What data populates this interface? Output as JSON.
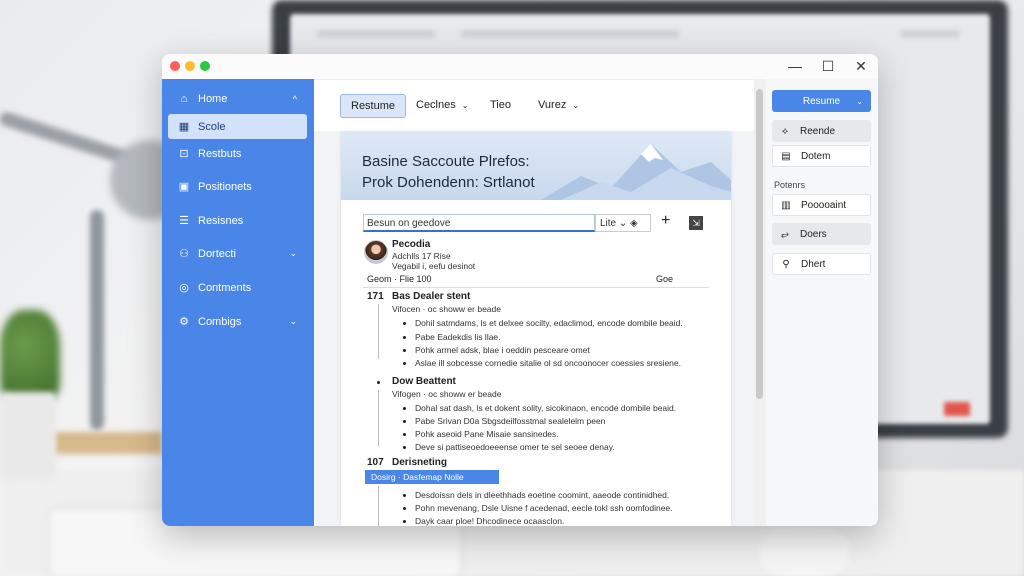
{
  "window": {
    "controls": {
      "minimize": "—",
      "maximize": "☐",
      "close": "✕"
    }
  },
  "sidebar": {
    "items": [
      {
        "label": "Home",
        "icon": "home-icon",
        "glyph": "⌂",
        "chevron": "^"
      },
      {
        "label": "Scole",
        "icon": "grid-icon",
        "glyph": "▦",
        "active": true
      },
      {
        "label": "Restbuts",
        "icon": "chart-icon",
        "glyph": "⊡"
      },
      {
        "label": "Positionets",
        "icon": "card-icon",
        "glyph": "▣"
      },
      {
        "label": "Resisnes",
        "icon": "list-icon",
        "glyph": "☰"
      },
      {
        "label": "Dortecti",
        "icon": "person-icon",
        "glyph": "⚇",
        "chevron": "⌄"
      },
      {
        "label": "Contments",
        "icon": "comment-icon",
        "glyph": "◎"
      },
      {
        "label": "Combigs",
        "icon": "gear-icon",
        "glyph": "⚙",
        "chevron": "⌄"
      }
    ]
  },
  "toolbar": {
    "tabs": [
      {
        "label": "Restume",
        "active": true
      },
      {
        "label": "Ceclnes",
        "chevron": "⌄"
      },
      {
        "label": "Tieo"
      },
      {
        "label": "Vurez",
        "chevron": "⌄"
      }
    ]
  },
  "doc": {
    "title_line1": "Basine Saccoute Plrefos:",
    "title_line2": "Prok Dohendenn: Srtlanot",
    "search_placeholder": "Besun on geedove",
    "lite": "Lite ⌄  ◈",
    "add": "+",
    "export": "⇲",
    "profile": {
      "name": "Pecodia",
      "line1": "Adchlls  17  Rise",
      "line2": "Vegabil  i, eefu  desinot"
    },
    "meta": {
      "left": "Geom   ·   Flie    100",
      "right": "Goe"
    },
    "section1": {
      "num": "171",
      "title": "Bas Dealer stent",
      "sub": "Vifocen · oc  showw  er  beade",
      "bullets": [
        "Dohil satmdams, ls et delxee socilty, edaclimod, encode dombile beaid.",
        "Pabe Eadekdis lis  llae.",
        "Pohk armel adsk, blae  i  oeddin pesceare omet",
        "Aslae ill sobcesse cornedie sitalie ol sd oncoonocer coessies sresiene."
      ]
    },
    "section2": {
      "title": "Dow Beattent",
      "sub": "Vifogen · oc  showw  er  beade",
      "bullets": [
        "Dohal sat dash, ls et dokent solity, sicokinaon, encode dombile beaid.",
        "Pabe Srivan D0a Sbgsdeilfosstmal sealelelm           peen",
        "Pohk aseoid Pane Misaie sansinedes.",
        "Deve si pattiseoedoeeense omer te sel  seoee denay."
      ]
    },
    "section3": {
      "num": "107",
      "title": "Derisneting",
      "selected": "Dosirg · Dasfemap Nolle",
      "bullets": [
        "Desdoissn dels in dleethhads eoetine coomint, aaeode continidhed.",
        "Pohn mevenang, Dsle  Uisne  f  acedenad, eecle tokl  ssh  oomfodinee.",
        "Dayk caar  ploe! Dhcodinece ocaasclon."
      ]
    }
  },
  "rightpanel": {
    "primary": {
      "label": "Resume",
      "chevron": "⌄"
    },
    "items": [
      {
        "label": "Reende",
        "icon": "cursor-icon",
        "glyph": "⟡",
        "style": "gray"
      },
      {
        "label": "Dotem",
        "icon": "layout-icon",
        "glyph": "▤",
        "style": "white"
      }
    ],
    "section_label": "Potenrs",
    "items2": [
      {
        "label": "Pooooaint",
        "icon": "document-icon",
        "glyph": "▥",
        "style": "white"
      },
      {
        "label": "Doers",
        "icon": "link-icon",
        "glyph": "⥂",
        "style": "gray"
      },
      {
        "label": "Dhert",
        "icon": "pin-icon",
        "glyph": "⚲",
        "style": "white"
      }
    ]
  }
}
